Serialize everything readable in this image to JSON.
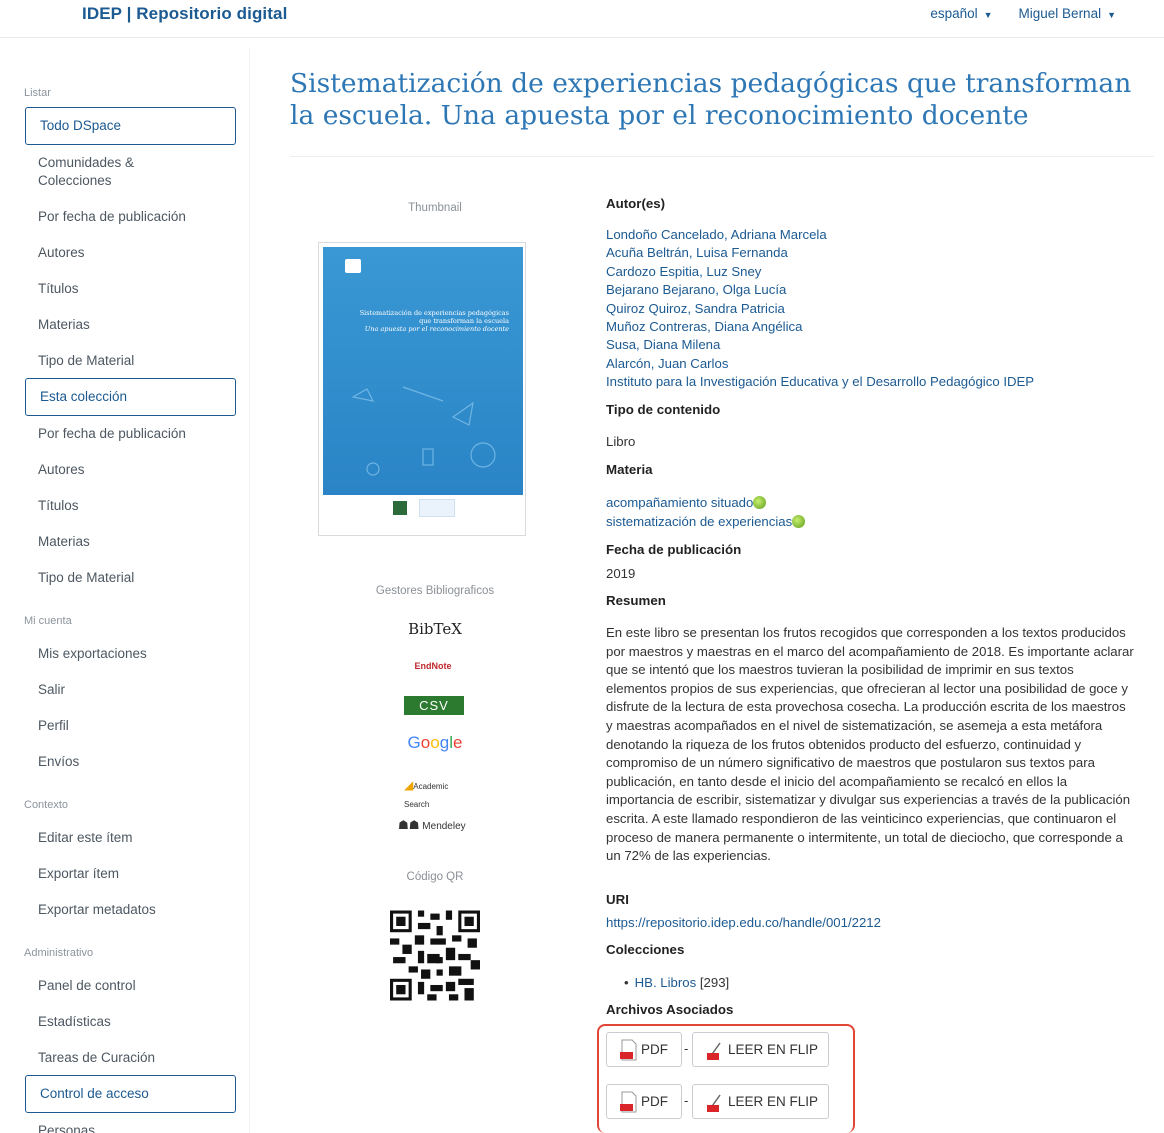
{
  "header": {
    "brand": "IDEP | Repositorio digital",
    "language": "español",
    "user": "Miguel Bernal"
  },
  "sidebar": {
    "listar_label": "Listar",
    "todo_dspace": "Todo DSpace",
    "global_items": [
      "Comunidades & Colecciones",
      "Por fecha de publicación",
      "Autores",
      "Títulos",
      "Materias",
      "Tipo de Material"
    ],
    "esta_coleccion": "Esta colección",
    "coleccion_items": [
      "Por fecha de publicación",
      "Autores",
      "Títulos",
      "Materias",
      "Tipo de Material"
    ],
    "mi_cuenta_label": "Mi cuenta",
    "cuenta_items": [
      "Mis exportaciones",
      "Salir",
      "Perfil",
      "Envíos"
    ],
    "contexto_label": "Contexto",
    "contexto_items": [
      "Editar este ítem",
      "Exportar ítem",
      "Exportar metadatos"
    ],
    "admin_label": "Administrativo",
    "admin_items": [
      "Panel de control",
      "Estadísticas",
      "Tareas de Curación"
    ],
    "control_acceso": "Control de acceso",
    "personas": "Personas"
  },
  "item": {
    "title": "Sistematización de experiencias pedagógicas que transforman la escuela. Una apuesta por el reconocimiento docente",
    "thumbnail_label": "Thumbnail",
    "cover_title": "Sistematización de experiencias pedagógicas que transforman la escuela",
    "cover_subtitle": "Una apuesta por el reconocimiento docente",
    "gestores_label": "Gestores Bibliograficos",
    "gestores": [
      "BibTeX",
      "EndNote",
      "CSV",
      "Google",
      "Academic Search",
      "Mendeley"
    ],
    "qr_label": "Código QR",
    "autores_head": "Autor(es)",
    "autores": [
      "Londoño Cancelado, Adriana Marcela",
      "Acuña Beltrán, Luisa Fernanda",
      "Cardozo Espitia, Luz Sney",
      "Bejarano Bejarano, Olga Lucía",
      "Quiroz Quiroz, Sandra Patricia",
      "Muñoz Contreras, Diana Angélica",
      "Susa, Diana Milena",
      "Alarcón, Juan Carlos",
      "Instituto para la Investigación Educativa y el Desarrollo Pedagógico IDEP"
    ],
    "tipo_head": "Tipo de contenido",
    "tipo": "Libro",
    "materia_head": "Materia",
    "materias": [
      "acompañamiento situado",
      "sistematización de experiencias"
    ],
    "fecha_head": "Fecha de publicación",
    "fecha": "2019",
    "resumen_head": "Resumen",
    "resumen": "En este libro se presentan los frutos recogidos que corresponden a los textos producidos por maestros y maestras en el marco del acompañamiento de 2018. Es importante aclarar que se intentó que los maestros tuvieran la posibilidad de imprimir en sus textos elementos propios de sus experiencias, que ofrecieran al lector una posibilidad de goce y disfrute de la lectura de esta provechosa cosecha. La producción escrita de los maestros y maestras acompañados en el nivel de sistematización, se asemeja a esta metáfora denotando la riqueza de los frutos obtenidos producto del esfuerzo, continuidad y compromiso de un número significativo de maestros que postularon sus textos para publicación, en tanto desde el inicio del acompañamiento se recalcó en ellos la importancia de escribir, sistematizar y divulgar sus experiencias a través de la publicación escrita. A este llamado respondieron de las veinticinco experiencias, que continuaron el proceso de manera permanente o intermitente, un total de dieciocho, que corresponde a un 72% de las experiencias.",
    "uri_head": "URI",
    "uri": "https://repositorio.idep.edu.co/handle/001/2212",
    "colecciones_head": "Colecciones",
    "coleccion_name": "HB. Libros",
    "coleccion_count": "[293]",
    "archivos_head": "Archivos Asociados",
    "pdf_label": "PDF",
    "flip_label": "LEER EN FLIP",
    "separator": "-"
  },
  "colors": {
    "brand": "#1c5a92",
    "title": "#2e77b5",
    "highlight": "#e24637"
  }
}
